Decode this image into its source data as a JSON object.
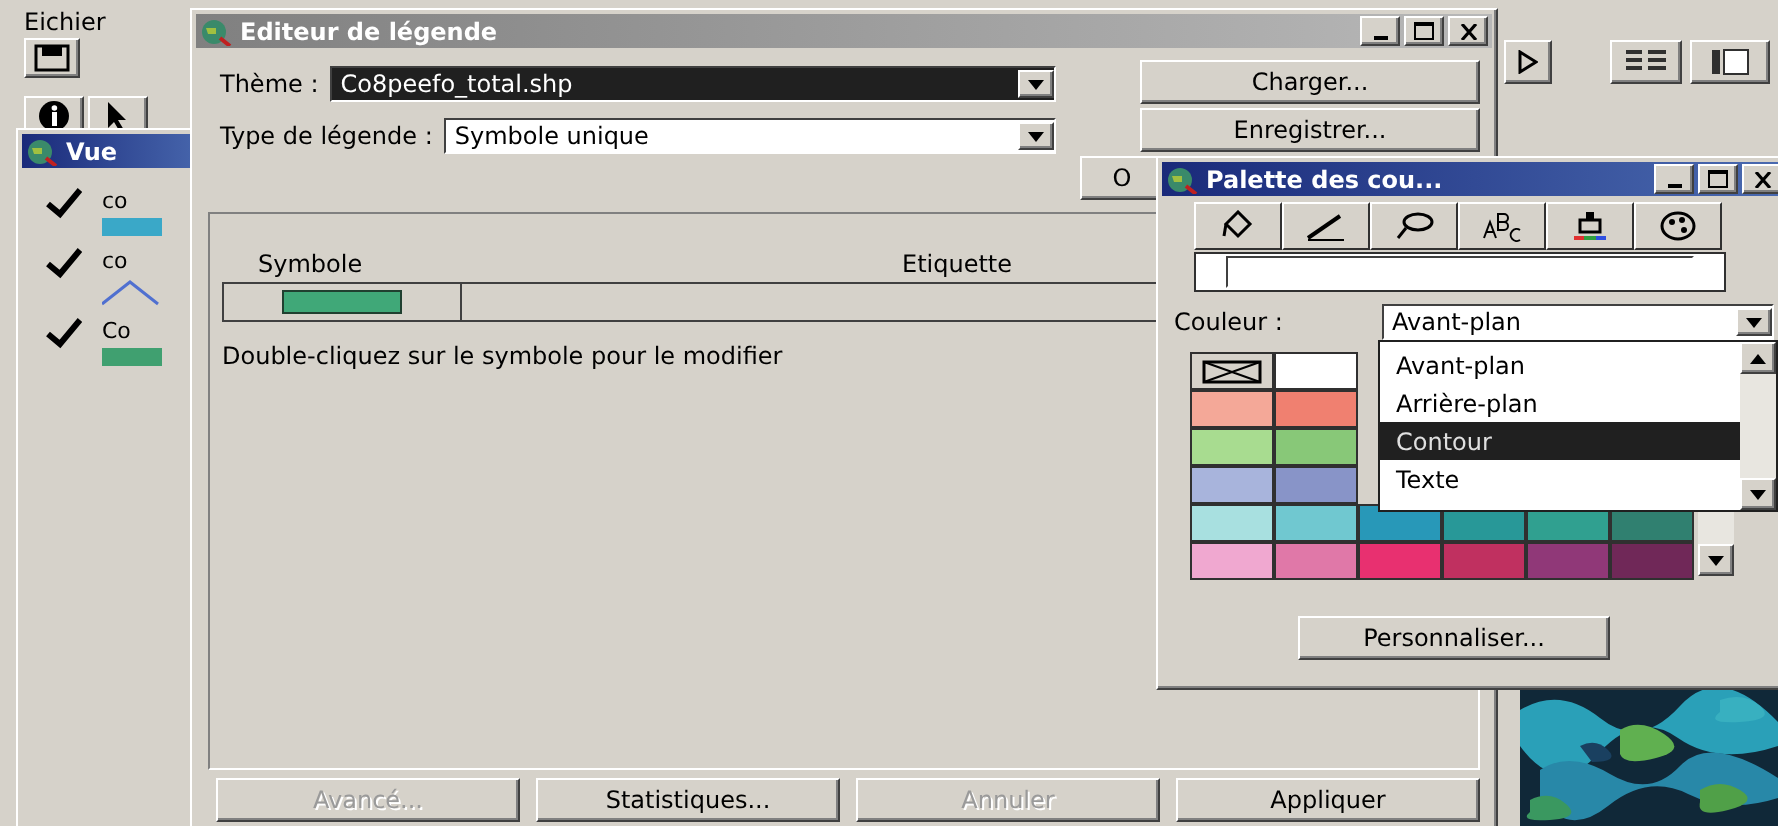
{
  "app": {
    "menu": [
      {
        "label": "Eichier"
      }
    ]
  },
  "view_window": {
    "title": "Vue",
    "layers": [
      {
        "name": "co",
        "visible": true,
        "kind": "fill",
        "color": "#3aa8c8"
      },
      {
        "name": "co",
        "visible": true,
        "kind": "line",
        "color": "#5070d0"
      },
      {
        "name": "Co",
        "visible": true,
        "kind": "fill",
        "color": "#40a070"
      }
    ]
  },
  "legend_editor": {
    "title": "Editeur de légende",
    "theme_label": "Thème :",
    "theme_value": "Co8peefo_total.shp",
    "type_label": "Type de légende :",
    "type_value": "Symbole unique",
    "side_buttons": [
      {
        "label": "Charger..."
      },
      {
        "label": "Enregistrer..."
      },
      {
        "label": "O"
      }
    ],
    "columns": [
      "Symbole",
      "Etiquette"
    ],
    "rows": [
      {
        "color": "#40a878"
      }
    ],
    "hint": "Double-cliquez sur le symbole pour le modifier",
    "buttons": [
      {
        "label": "Avancé...",
        "disabled": true
      },
      {
        "label": "Statistiques...",
        "disabled": false
      },
      {
        "label": "Annuler",
        "disabled": true
      },
      {
        "label": "Appliquer",
        "disabled": false
      }
    ]
  },
  "palette": {
    "title": "Palette des cou...",
    "tools": [
      {
        "kind": "fill"
      },
      {
        "kind": "pen"
      },
      {
        "kind": "marker"
      },
      {
        "kind": "text"
      },
      {
        "kind": "color"
      },
      {
        "kind": "palette"
      }
    ],
    "color_label": "Couleur :",
    "color_value": "Avant-plan",
    "options": [
      {
        "label": "Avant-plan",
        "selected": false
      },
      {
        "label": "Arrière-plan",
        "selected": false
      },
      {
        "label": "Contour",
        "selected": true
      },
      {
        "label": "Texte",
        "selected": false
      }
    ],
    "swatches": [
      [
        {
          "kind": "none"
        },
        {
          "kind": "color",
          "color": "#ffffff"
        }
      ],
      [
        {
          "kind": "color",
          "color": "#f4a898"
        },
        {
          "kind": "color",
          "color": "#f08070"
        }
      ],
      [
        {
          "kind": "color",
          "color": "#a8dc90"
        },
        {
          "kind": "color",
          "color": "#88c878"
        }
      ],
      [
        {
          "kind": "color",
          "color": "#a8b4dc"
        },
        {
          "kind": "color",
          "color": "#8894c8"
        }
      ],
      [
        {
          "kind": "color",
          "color": "#a8e0e0"
        },
        {
          "kind": "color",
          "color": "#70c8d0"
        },
        {
          "kind": "color",
          "color": "#2898b8"
        },
        {
          "kind": "color",
          "color": "#289898"
        },
        {
          "kind": "color",
          "color": "#30a090"
        },
        {
          "kind": "color",
          "color": "#308070"
        }
      ],
      [
        {
          "kind": "color",
          "color": "#f0a8d0"
        },
        {
          "kind": "color",
          "color": "#e078a8"
        },
        {
          "kind": "color",
          "color": "#e83070"
        },
        {
          "kind": "color",
          "color": "#c03060"
        },
        {
          "kind": "color",
          "color": "#903878"
        },
        {
          "kind": "color",
          "color": "#702858"
        }
      ]
    ],
    "customize": "Personnaliser..."
  }
}
